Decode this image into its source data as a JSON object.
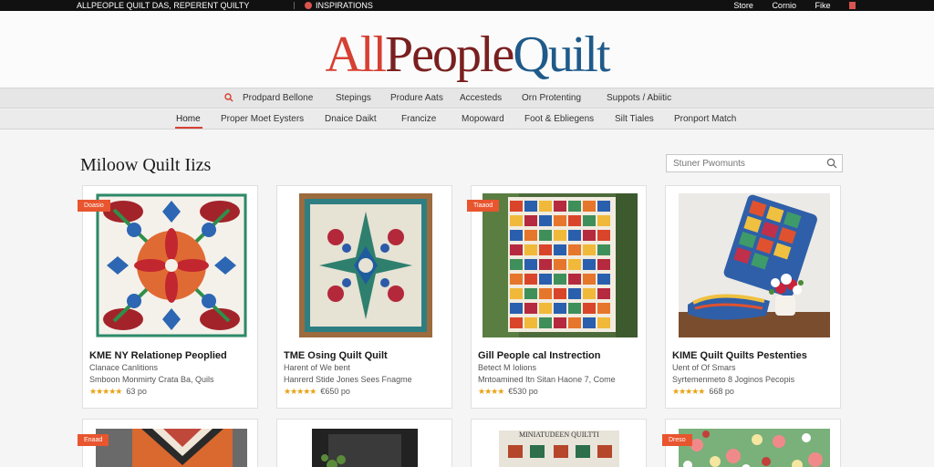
{
  "topbar": {
    "left_text": "ALLPEOPLE QUILT DAS, REPERENT QUILTY",
    "middle_text": "INSPIRATIONS",
    "right_links": [
      "Store",
      "Cornio",
      "Fike"
    ]
  },
  "logo": {
    "part1": "All",
    "part2": "People",
    "part3": "Quilt"
  },
  "nav_primary": {
    "search_label": "Prodpard Bellone",
    "items": [
      "Stepings",
      "Produre Aats",
      "Accesteds",
      "Orn Protenting",
      "Suppots / Abiitic"
    ]
  },
  "nav_secondary": {
    "items": [
      "Home",
      "Proper Moet Eysters",
      "Dnaice Daikt",
      "Francize",
      "Mopoward",
      "Foot & Ebliegens",
      "Silt Tiales",
      "Pronport Match"
    ]
  },
  "main": {
    "title": "Miloow Quilt Iizs",
    "search_placeholder": "Stuner Pwomunts"
  },
  "products": [
    {
      "badge": "Doasio",
      "title": "KME NY Relationep Peoplied",
      "sub1": "Clanace Canlitions",
      "sub2": "Smboon Monmirty Crata Ba, Quils",
      "stars": "★★★★★",
      "rating": "63 po"
    },
    {
      "badge": "",
      "title": "TME Osing Quilt Quilt",
      "sub1": "Harent of We bent",
      "sub2": "Hanrerd Stide Jones Sees Fnagme",
      "stars": "★★★★★",
      "rating": "€650 po"
    },
    {
      "badge": "Tiaaod",
      "title": "Gill People cal Instrection",
      "sub1": "Betect M Iolions",
      "sub2": "Mntoamined Itn Sitan Haone 7, Come",
      "stars": "★★★★",
      "rating": "€530 po"
    },
    {
      "badge": "",
      "title": "KIME Quilt Quilts Pestenties",
      "sub1": "Uent of Of Smars",
      "sub2": "Syrtemenmeto 8 Joginos Pecopis",
      "stars": "★★★★★",
      "rating": "668 po"
    }
  ],
  "products_row2": [
    {
      "badge": "Enaad"
    },
    {
      "badge": ""
    },
    {
      "badge": "",
      "caption": "MINIATUDEEN QUILTTI"
    },
    {
      "badge": "Dreso"
    }
  ],
  "colors": {
    "logo_red": "#d64032",
    "logo_maroon": "#7a1f1f",
    "logo_blue": "#1f5a8a",
    "badge": "#e8552e",
    "star": "#e8a317"
  }
}
